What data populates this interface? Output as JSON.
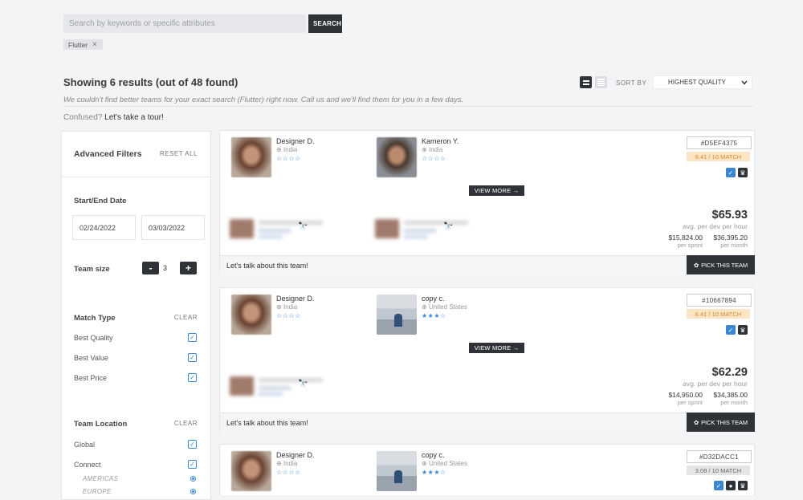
{
  "search": {
    "placeholder": "Search by keywords or specific attributes",
    "button_label": "SEARCH",
    "tags": [
      {
        "label": "Flutter",
        "remove_icon": "close-icon"
      }
    ]
  },
  "results": {
    "title": "Showing 6 results (out of 48 found)",
    "notice": "We couldn't find better teams for your exact search (Flutter) right now. Call us and we'll find them for you in a few days.",
    "tour_prefix": "Confused?",
    "tour_link": "Let's take a tour!",
    "sort_label": "SORT BY",
    "sort_value": "HIGHEST QUALITY",
    "view_icons": [
      "grid-view-icon",
      "list-view-icon"
    ]
  },
  "filters": {
    "title": "Advanced Filters",
    "reset_label": "RESET ALL",
    "date_label": "Start/End Date",
    "start_date": "02/24/2022",
    "end_date": "03/03/2022",
    "team_size_label": "Team size",
    "team_size_value": "3",
    "minus_label": "-",
    "plus_label": "+",
    "match_type_label": "Match Type",
    "match_type_clear": "CLEAR",
    "match_options": [
      {
        "label": "Best Quality",
        "checked": true
      },
      {
        "label": "Best Value",
        "checked": true
      },
      {
        "label": "Best Price",
        "checked": true
      }
    ],
    "location_label": "Team Location",
    "location_clear": "CLEAR",
    "location_options": [
      {
        "label": "Global",
        "checked": true
      },
      {
        "label": "Connect",
        "checked": true
      }
    ],
    "sub_regions": [
      {
        "label": "AMERICAS"
      },
      {
        "label": "EUROPE"
      }
    ]
  },
  "cards": [
    {
      "members": [
        {
          "name": "Designer D.",
          "location": "India",
          "stars": "☆☆☆☆"
        },
        {
          "name": "Kameron Y.",
          "location": "India",
          "stars": "☆☆☆☆"
        }
      ],
      "view_more": "VIEW MORE →",
      "team_id": "#D5EF4375",
      "match": "6.41 / 10 MATCH",
      "match_color": "#fbe5c5",
      "price": "$65.93",
      "price_sub": "avg. per dev per hour",
      "sprint_value": "$15,824.00",
      "sprint_label": "per sprint",
      "month_value": "$36,395.20",
      "month_label": "per month",
      "talk": "Let's talk about this team!",
      "pick": "PICK THIS TEAM"
    },
    {
      "members": [
        {
          "name": "Designer D.",
          "location": "India",
          "stars": "☆☆☆☆"
        },
        {
          "name": "copy c.",
          "location": "United States",
          "stars": "★★★☆"
        }
      ],
      "view_more": "VIEW MORE →",
      "team_id": "#10667894",
      "match": "6.41 / 10 MATCH",
      "match_color": "#fbe5c5",
      "price": "$62.29",
      "price_sub": "avg. per dev per hour",
      "sprint_value": "$14,950.00",
      "sprint_label": "per sprint",
      "month_value": "$34,385.00",
      "month_label": "per month",
      "talk": "Let's talk about this team!",
      "pick": "PICK THIS TEAM"
    },
    {
      "members": [
        {
          "name": "Designer D.",
          "location": "India",
          "stars": "☆☆☆☆"
        },
        {
          "name": "copy c.",
          "location": "United States",
          "stars": "★★★☆"
        }
      ],
      "team_id": "#D32DACC1",
      "match": "3.08 / 10 MATCH",
      "match_color": "#e4e5e7"
    }
  ]
}
